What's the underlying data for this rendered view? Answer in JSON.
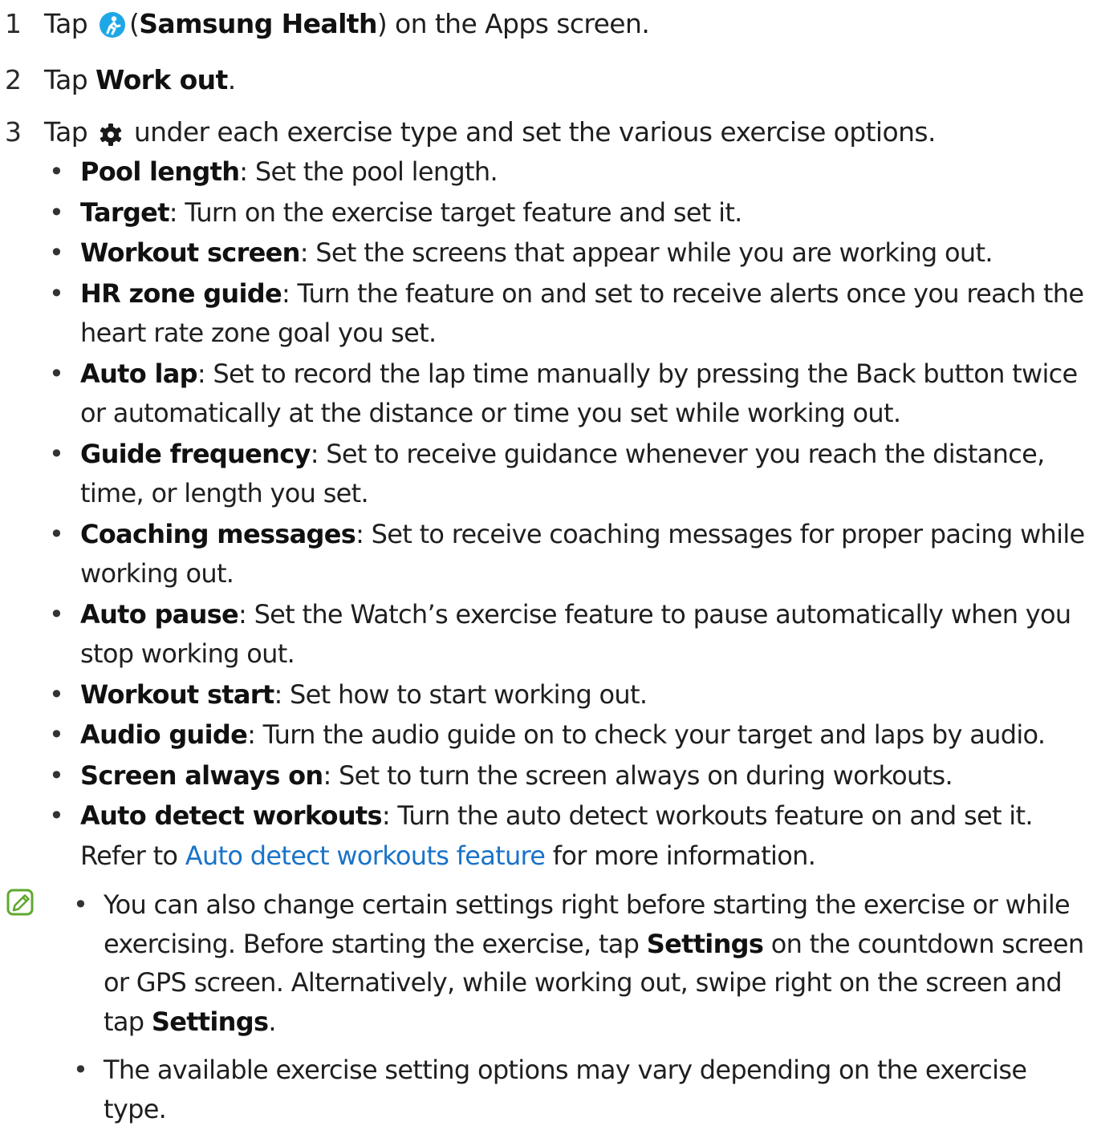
{
  "steps": [
    {
      "num": "1",
      "pre": "Tap",
      "icon": "samsung-health-app-icon",
      "bold": "Samsung Health",
      "post": "on the Apps screen."
    },
    {
      "num": "2",
      "pre": "Tap",
      "bold": "Work out",
      "post": "."
    },
    {
      "num": "3",
      "pre": "Tap",
      "icon": "gear-icon",
      "post": "under each exercise type and set the various exercise options."
    }
  ],
  "options": [
    {
      "name": "Pool length",
      "desc": ": Set the pool length."
    },
    {
      "name": "Target",
      "desc": ": Turn on the exercise target feature and set it."
    },
    {
      "name": "Workout screen",
      "desc": ": Set the screens that appear while you are working out."
    },
    {
      "name": "HR zone guide",
      "desc": ": Turn the feature on and set to receive alerts once you reach the heart rate zone goal you set."
    },
    {
      "name": "Auto lap",
      "desc": ": Set to record the lap time manually by pressing the Back button twice or automatically at the distance or time you set while working out."
    },
    {
      "name": "Guide frequency",
      "desc": ": Set to receive guidance whenever you reach the distance, time, or length you set."
    },
    {
      "name": "Coaching messages",
      "desc": ": Set to receive coaching messages for proper pacing while working out."
    },
    {
      "name": "Auto pause",
      "desc": ": Set the Watch’s exercise feature to pause automatically when you stop working out."
    },
    {
      "name": "Workout start",
      "desc": ": Set how to start working out."
    },
    {
      "name": "Audio guide",
      "desc": ": Turn the audio guide on to check your target and laps by audio."
    },
    {
      "name": "Screen always on",
      "desc": ": Set to turn the screen always on during workouts."
    },
    {
      "name": "Auto detect workouts",
      "desc": ": Turn the auto detect workouts feature on and set it. Refer to",
      "link": "Auto detect workouts feature",
      "tail": "for more information."
    }
  ],
  "notes": {
    "icon": "note-pencil-icon",
    "note1": {
      "t1": "You can also change certain settings right before starting the exercise or while exercising. Before starting the exercise, tap",
      "b1": "Settings",
      "t2": "on the countdown screen or GPS screen. Alternatively, while working out, swipe right on the screen and tap",
      "b2": "Settings",
      "t3": "."
    },
    "note2": "The available exercise setting options may vary depending on the exercise type."
  },
  "colors": {
    "link": "#1a73c8",
    "note_icon": "#5fa92f",
    "health_icon": "#1ea7e6"
  }
}
